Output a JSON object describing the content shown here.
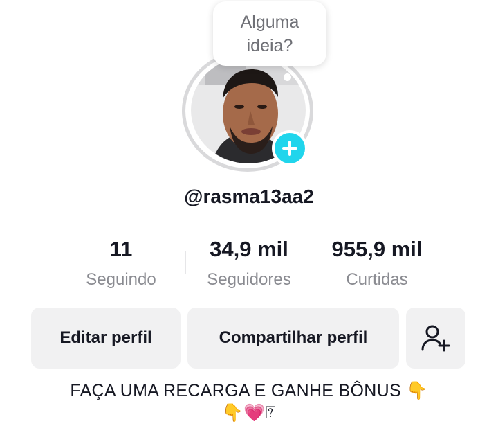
{
  "tooltip": {
    "line1": "Alguma",
    "line2": "ideia?"
  },
  "profile": {
    "username": "@rasma13aa2"
  },
  "stats": [
    {
      "value": "11",
      "label": "Seguindo"
    },
    {
      "value": "34,9 mil",
      "label": "Seguidores"
    },
    {
      "value": "955,9 mil",
      "label": "Curtidas"
    }
  ],
  "buttons": {
    "edit_profile": "Editar perfil",
    "share_profile": "Compartilhar perfil",
    "add_friend_icon": "person-plus-icon"
  },
  "bio": {
    "line1_text": "FAÇA UMA RECARGA E GANHE BÔNUS ",
    "line1_emoji": "👇",
    "line2_emoji1": "👇",
    "line2_emoji2": "💗",
    "line2_missing": "⍰"
  },
  "colors": {
    "accent_plus": "#20d5ec",
    "button_bg": "#f1f1f2",
    "secondary_text": "#8a8b91",
    "primary_text": "#161823"
  }
}
